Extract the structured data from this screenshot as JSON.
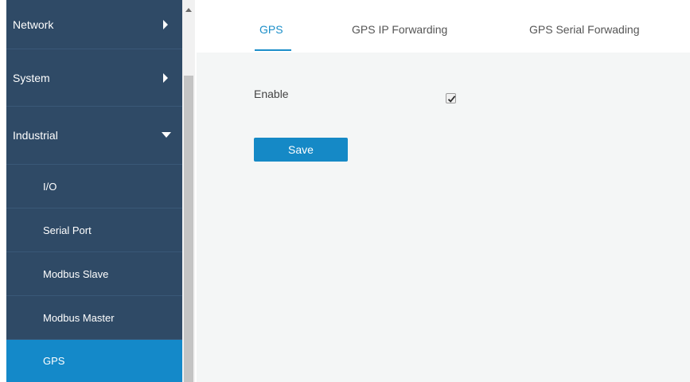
{
  "sidebar": {
    "items": [
      {
        "label": "Network"
      },
      {
        "label": "System"
      },
      {
        "label": "Industrial"
      },
      {
        "label": "I/O"
      },
      {
        "label": "Serial Port"
      },
      {
        "label": "Modbus Slave"
      },
      {
        "label": "Modbus Master"
      },
      {
        "label": "GPS"
      }
    ]
  },
  "tabs": [
    {
      "label": "GPS"
    },
    {
      "label": "GPS IP Forwarding"
    },
    {
      "label": "GPS Serial Forwading"
    }
  ],
  "form": {
    "enable_label": "Enable",
    "enable_checked": true,
    "save_label": "Save"
  },
  "colors": {
    "sidebar_bg": "#2f4a66",
    "active_item": "#1489c9",
    "accent": "#1c8fc9",
    "panel_bg": "#f4f6f6"
  }
}
